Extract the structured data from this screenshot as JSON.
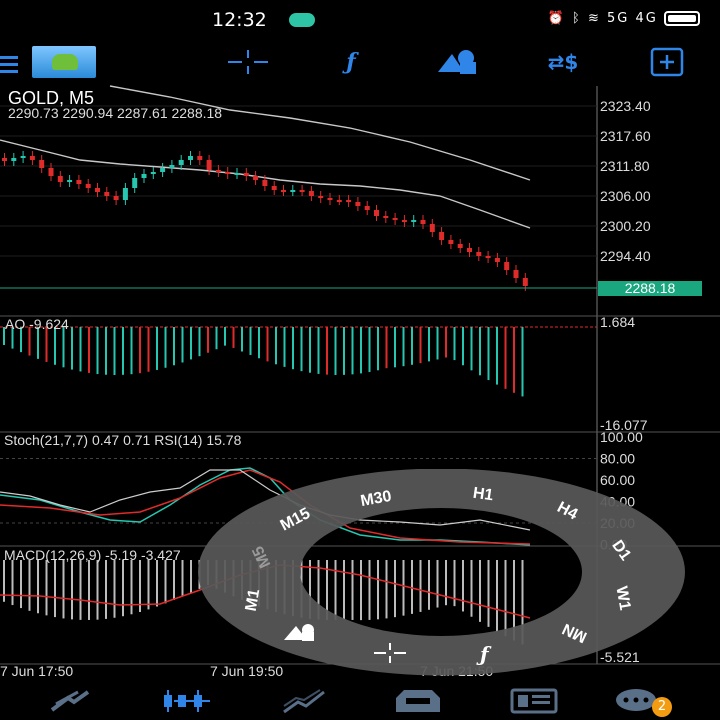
{
  "status_bar": {
    "time": "12:32",
    "signal_text": "5G  4G"
  },
  "chart": {
    "symbol_title": "GOLD, M5",
    "ohlc": "2290.73 2290.94 2287.61 2288.18",
    "current_price": "2288.18",
    "price_ticks": [
      "2323.40",
      "2317.60",
      "2311.80",
      "2306.00",
      "2300.20",
      "2294.40"
    ],
    "colors": {
      "bull": "#26c6b0",
      "bear": "#e02b2b",
      "price_line": "#1aa67f",
      "ma": "#c8c8c8"
    }
  },
  "ao": {
    "label": "AO -9.624",
    "top_tick": "1.684",
    "bottom_tick": "-16.077"
  },
  "stoch": {
    "label": "Stoch(21,7,7) 0.47 0.71 RSI(14) 15.78",
    "ticks": [
      "100.00",
      "80.00",
      "60.00",
      "40.00",
      "20.00",
      "0.00"
    ]
  },
  "macd": {
    "label": "MACD(12,26,9) -5.19 -3.427",
    "bottom_tick": "-5.521"
  },
  "time_axis": [
    "7 Jun 17:50",
    "7 Jun 19:50",
    "7 Jun 21:50"
  ],
  "timeframe_wheel": {
    "items": [
      "M15",
      "M30",
      "H1",
      "H4",
      "D1",
      "W1",
      "MN",
      "M5",
      "M1"
    ]
  },
  "toolbar_icons": [
    "menu-icon",
    "metatrader-icon",
    "crosshair-icon",
    "function-icon",
    "objects-icon",
    "symbol-icon",
    "new-chart-icon"
  ],
  "bottom_nav": {
    "items": [
      "quotes-icon",
      "chart-icon",
      "trade-icon",
      "history-icon",
      "news-icon",
      "messages-icon"
    ],
    "notification_count": "2"
  }
}
